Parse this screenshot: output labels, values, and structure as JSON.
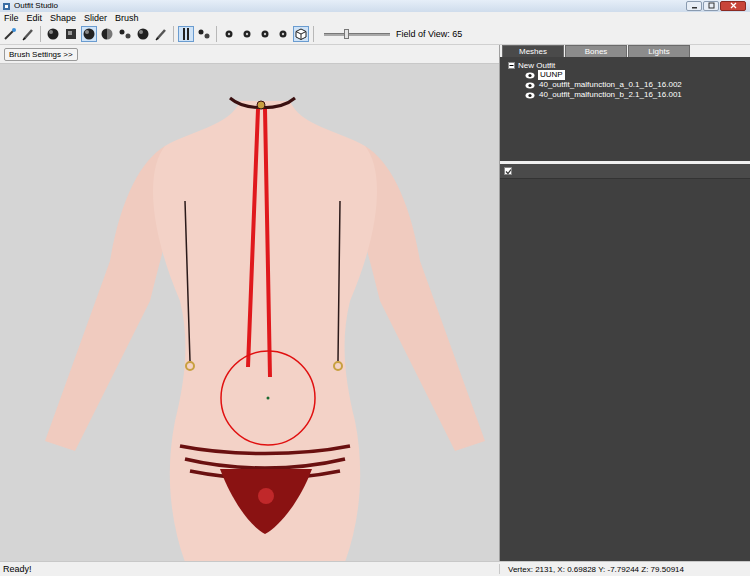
{
  "window": {
    "title": "Outfit Studio"
  },
  "menu": [
    "File",
    "Edit",
    "Shape",
    "Slider",
    "Brush"
  ],
  "toolbar": {
    "tool_groups": [
      [
        {
          "selected": false
        },
        {
          "selected": false
        }
      ],
      [
        {
          "selected": false
        },
        {
          "selected": false
        },
        {
          "selected": true
        },
        {
          "selected": false
        },
        {
          "selected": false
        },
        {
          "selected": false
        },
        {
          "selected": false
        }
      ],
      [
        {
          "selected": true
        },
        {
          "selected": false
        }
      ],
      [
        {
          "selected": false
        },
        {
          "selected": false
        },
        {
          "selected": false
        },
        {
          "selected": false
        },
        {
          "selected": true
        }
      ]
    ],
    "fov": {
      "label": "Field of View: 65",
      "level": 0.33
    }
  },
  "brush_settings_button": "Brush Settings >>",
  "tabs": [
    {
      "label": "Meshes",
      "selected": true
    },
    {
      "label": "Bones",
      "selected": false
    },
    {
      "label": "Lights",
      "selected": false
    }
  ],
  "tree": {
    "root": "New Outfit",
    "expanded": true,
    "items": [
      {
        "label": "UUNP",
        "visible": true,
        "selected": true
      },
      {
        "label": "40_outfit_malfunction_a_0.1_16_16.002",
        "visible": true,
        "selected": false
      },
      {
        "label": "40_outfit_malfunction_b_2.1_16_16.001",
        "visible": true,
        "selected": false
      }
    ]
  },
  "slider_panel": {
    "checked": true
  },
  "status_bar": {
    "message": "Ready!",
    "vertex": "Vertex: 2131, X: 0.69828 Y: -7.79244 Z: 79.50914"
  }
}
